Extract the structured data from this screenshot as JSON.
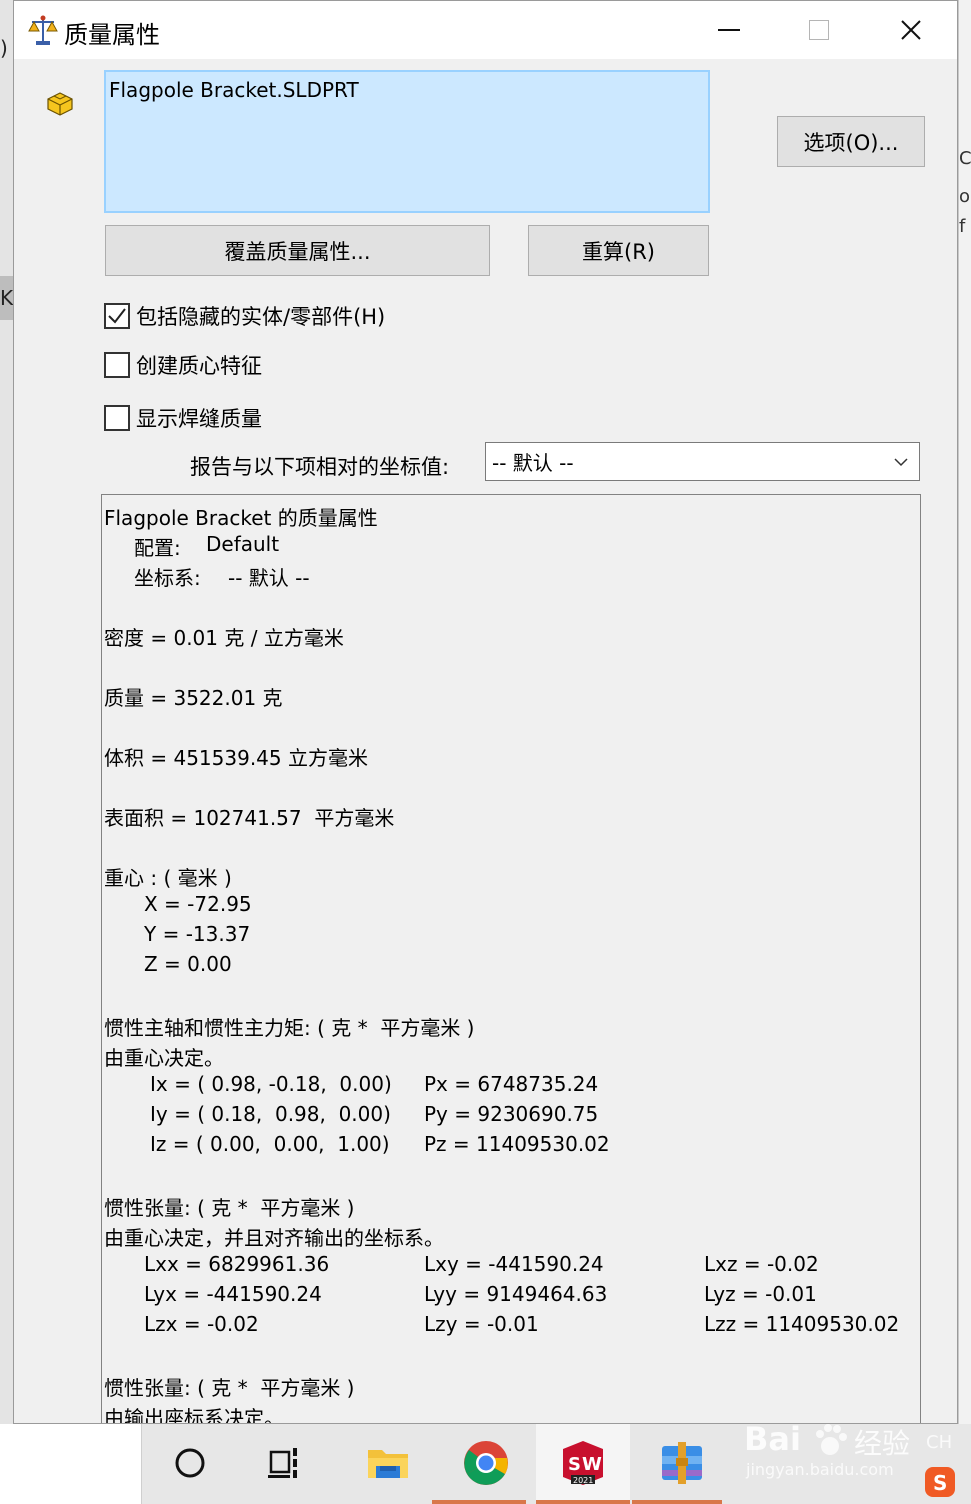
{
  "window": {
    "title": "质量属性",
    "controls": [
      "minimize",
      "maximize",
      "close"
    ]
  },
  "background": {
    "left_fragments": [
      ")",
      "K"
    ],
    "right_fragments": [
      "C",
      "o",
      "f",
      "…"
    ]
  },
  "selection": {
    "items": [
      "Flagpole Bracket.SLDPRT"
    ]
  },
  "buttons": {
    "options": "选项(O)...",
    "override": "覆盖质量属性...",
    "recalculate": "重算(R)"
  },
  "checkboxes": [
    {
      "label": "包括隐藏的实体/零部件(H)",
      "checked": true
    },
    {
      "label": "创建质心特征",
      "checked": false
    },
    {
      "label": "显示焊缝质量",
      "checked": false
    }
  ],
  "coordinate": {
    "label": "报告与以下项相对的坐标值:",
    "selected": "-- 默认 --"
  },
  "results": {
    "title": "Flagpole Bracket 的质量属性",
    "config_label": "配置:",
    "config_value": "Default",
    "coord_label": "坐标系:",
    "coord_value": "-- 默认 --",
    "density": "密度 = 0.01 克 / 立方毫米",
    "mass": "质量 = 3522.01 克",
    "volume": "体积 = 451539.45 立方毫米",
    "surface_area": "表面积 = 102741.57  平方毫米",
    "cg_heading": "重心 : ( 毫米 )",
    "cg": [
      "X = -72.95",
      "Y = -13.37",
      "Z = 0.00"
    ],
    "principal_heading": "惯性主轴和惯性主力矩: ( 克 *  平方毫米 )",
    "principal_sub": "由重心决定。",
    "principal_axes": [
      {
        "axis": "Ix = ( 0.98, -0.18,  0.00)",
        "moment": "Px = 6748735.24"
      },
      {
        "axis": "Iy = ( 0.18,  0.98,  0.00)",
        "moment": "Py = 9230690.75"
      },
      {
        "axis": "Iz = ( 0.00,  0.00,  1.00)",
        "moment": "Pz = 11409530.02"
      }
    ],
    "tensor1_heading": "惯性张量: ( 克 *  平方毫米 )",
    "tensor1_sub": "由重心决定，并且对齐输出的坐标系。",
    "tensor1": [
      [
        "Lxx = 6829961.36",
        "Lxy = -441590.24",
        "Lxz = -0.02"
      ],
      [
        "Lyx = -441590.24",
        "Lyy = 9149464.63",
        "Lyz = -0.01"
      ],
      [
        "Lzx = -0.02",
        "Lzy = -0.01",
        "Lzz = 11409530.02"
      ]
    ],
    "tensor2_heading": "惯性张量: ( 克 *  平方毫米 )",
    "tensor2_sub": "由输出座标系决定。"
  },
  "taskbar": {
    "items": [
      "cortana-icon",
      "task-view-icon",
      "file-explorer-icon",
      "chrome-icon",
      "solidworks-icon",
      "winrar-icon"
    ],
    "solidworks_badge": "2021"
  },
  "watermark": {
    "brand": "Bai",
    "brand_suffix": "经验",
    "url": "jingyan.baidu.com",
    "lang": "CH"
  }
}
